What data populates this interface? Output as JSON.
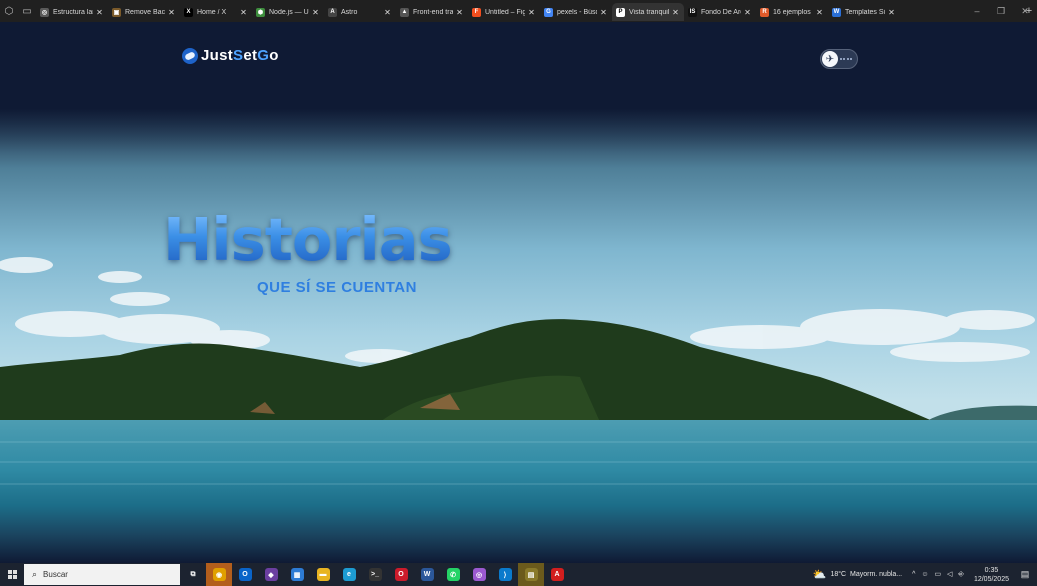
{
  "browser": {
    "tabs": [
      {
        "title": "Estructura lan",
        "favicon_color": "#5a5a5a",
        "favicon_glyph": "◎",
        "active": false
      },
      {
        "title": "Remove Back",
        "favicon_color": "#7b5a2a",
        "favicon_glyph": "▣",
        "active": false
      },
      {
        "title": "Home / X",
        "favicon_color": "#000000",
        "favicon_glyph": "X",
        "active": false
      },
      {
        "title": "Node.js — Ur",
        "favicon_color": "#3e8e3e",
        "favicon_glyph": "⬢",
        "active": false
      },
      {
        "title": "Astro",
        "favicon_color": "#444444",
        "favicon_glyph": "A",
        "active": false
      },
      {
        "title": "Front-end tra",
        "favicon_color": "#555555",
        "favicon_glyph": "▲",
        "active": false
      },
      {
        "title": "Untitled – Fig",
        "favicon_color": "#f24e1e",
        "favicon_glyph": "F",
        "active": false
      },
      {
        "title": "pexels - Búsq",
        "favicon_color": "#4285f4",
        "favicon_glyph": "G",
        "active": false
      },
      {
        "title": "Vista tranquil",
        "favicon_color": "#ffffff",
        "favicon_glyph": "P",
        "active": true
      },
      {
        "title": "Fondo De Arc",
        "favicon_color": "#111111",
        "favicon_glyph": "IS",
        "active": false
      },
      {
        "title": "16 ejemplos d",
        "favicon_color": "#e05a2a",
        "favicon_glyph": "R",
        "active": false
      },
      {
        "title": "Templates Sit",
        "favicon_color": "#2a6fd6",
        "favicon_glyph": "W",
        "active": false
      }
    ],
    "new_tab_label": "+",
    "window_controls": {
      "minimize": "–",
      "restore": "❐",
      "close": "✕"
    }
  },
  "page": {
    "logo": {
      "part1": "Just",
      "part2": "S",
      "part3": "et",
      "part4": "G",
      "part5": "o",
      "icon": "globe-plane-icon"
    },
    "toggle": {
      "icon": "plane-icon",
      "glyph": "✈"
    },
    "hero": {
      "title": "Historias",
      "subtitle": "QUE SÍ SE CUENTAN"
    }
  },
  "taskbar": {
    "search_placeholder": "Buscar",
    "apps": [
      {
        "name": "task-view-icon",
        "glyph": "⧉",
        "color": "#1c2330",
        "state": ""
      },
      {
        "name": "chrome-canary-icon",
        "glyph": "◉",
        "color": "#e0a000",
        "state": "sel"
      },
      {
        "name": "outlook-icon",
        "glyph": "O",
        "color": "#0a64c9",
        "state": ""
      },
      {
        "name": "visual-studio-icon",
        "glyph": "◆",
        "color": "#6b3fa0",
        "state": ""
      },
      {
        "name": "store-icon",
        "glyph": "▦",
        "color": "#2d7bd4",
        "state": ""
      },
      {
        "name": "file-explorer-icon",
        "glyph": "▬",
        "color": "#e8b422",
        "state": ""
      },
      {
        "name": "edge-icon",
        "glyph": "e",
        "color": "#1d9bd1",
        "state": ""
      },
      {
        "name": "terminal-icon",
        "glyph": ">_",
        "color": "#333333",
        "state": ""
      },
      {
        "name": "opera-icon",
        "glyph": "O",
        "color": "#cc1b2b",
        "state": ""
      },
      {
        "name": "word-icon",
        "glyph": "W",
        "color": "#2b579a",
        "state": ""
      },
      {
        "name": "whatsapp-icon",
        "glyph": "✆",
        "color": "#25d366",
        "state": ""
      },
      {
        "name": "chrome-icon",
        "glyph": "◎",
        "color": "#9b59d0",
        "state": ""
      },
      {
        "name": "vscode-icon",
        "glyph": "⟩",
        "color": "#0a7acc",
        "state": ""
      },
      {
        "name": "clapper-icon",
        "glyph": "▤",
        "color": "#8a7a2a",
        "state": "yellow"
      },
      {
        "name": "acrobat-icon",
        "glyph": "A",
        "color": "#d21e1e",
        "state": ""
      }
    ],
    "weather": {
      "temp": "18°C",
      "desc": "Mayorm. nubla..."
    },
    "tray_icons": "^ ☺ ▭ ◁ ⎆",
    "time": "0:35",
    "date": "12/05/2025",
    "notif_badge": "1"
  }
}
